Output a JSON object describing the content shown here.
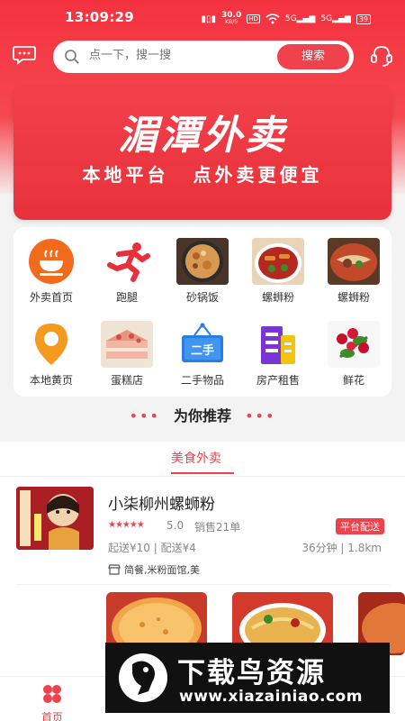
{
  "status_bar": {
    "time": "13:09:29",
    "net_speed": "30.0",
    "net_unit": "KB/S",
    "hd": "HD",
    "signal1": "5G",
    "signal2": "5G",
    "battery": "39"
  },
  "header": {
    "search_placeholder": "点一下，搜一搜",
    "search_button": "搜索"
  },
  "banner": {
    "title": "湄潭外卖",
    "subtitle_left": "本地平台",
    "subtitle_right": "点外卖更便宜"
  },
  "categories": [
    {
      "label": "外卖首页",
      "icon": "takeout-bowl-icon"
    },
    {
      "label": "跑腿",
      "icon": "runner-icon"
    },
    {
      "label": "砂锅饭",
      "icon": "claypot-rice-photo"
    },
    {
      "label": "螺蛳粉",
      "icon": "snail-noodle-photo"
    },
    {
      "label": "螺蛳粉",
      "icon": "snail-noodle-photo"
    },
    {
      "label": "本地黄页",
      "icon": "location-pin-icon"
    },
    {
      "label": "蛋糕店",
      "icon": "cake-photo"
    },
    {
      "label": "二手物品",
      "icon": "second-hand-sign-icon"
    },
    {
      "label": "房产租售",
      "icon": "building-icon"
    },
    {
      "label": "鲜花",
      "icon": "flowers-photo"
    }
  ],
  "recommend": {
    "title": "为你推荐",
    "tab": "美食外卖"
  },
  "shop": {
    "name": "小柒柳州螺蛳粉",
    "rating": "5.0",
    "sales": "销售21单",
    "badge": "平台配送",
    "delivery": "起送¥10 | 配送¥4",
    "time_distance": "36分钟 | 1.8km",
    "tags": "简餐,米粉面馆,美",
    "stars": 5
  },
  "bottom_nav": {
    "home": "首页"
  },
  "watermark": {
    "title": "下载鸟资源",
    "url": "www.xiazainiao.com"
  },
  "colors": {
    "brand_red": "#f0424d"
  }
}
